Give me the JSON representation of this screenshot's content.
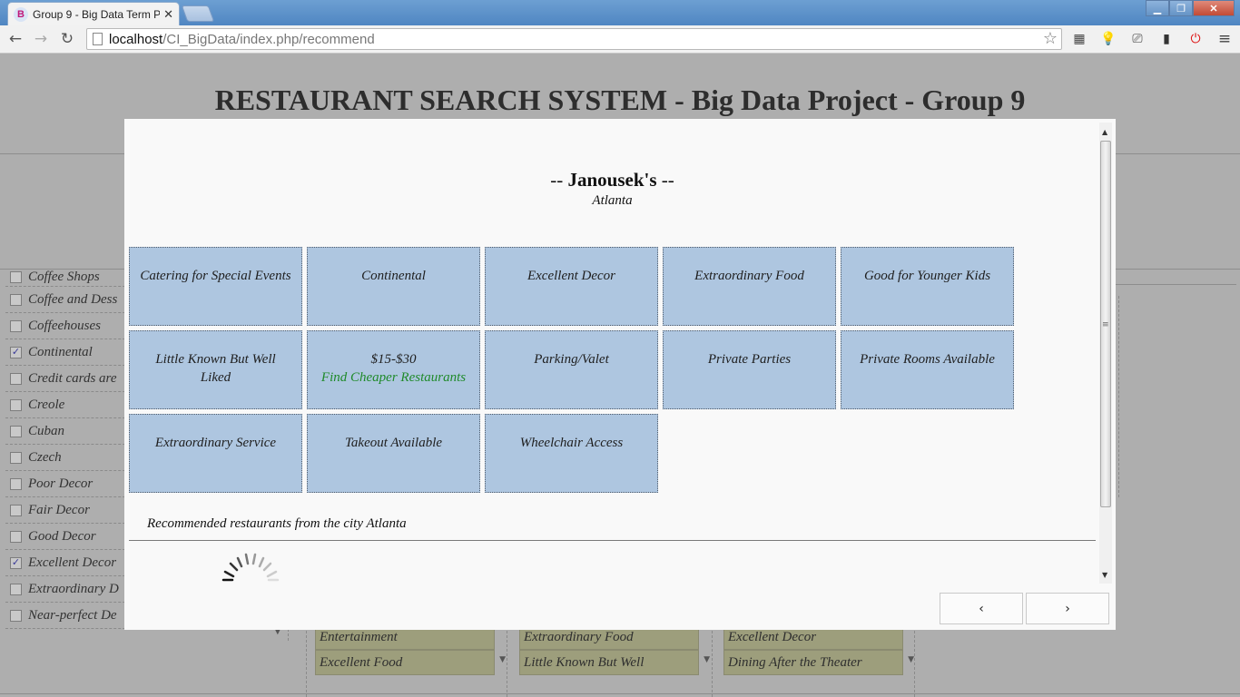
{
  "browser": {
    "tab_title": "Group 9 - Big Data Term P",
    "tab_favicon": "B",
    "url_host": "localhost",
    "url_path": "/CI_BigData/index.php/recommend"
  },
  "page": {
    "title": "RESTAURANT SEARCH SYSTEM - Big Data Project - Group 9",
    "filters": [
      {
        "label": "Coffee Shops",
        "checked": false
      },
      {
        "label": "Coffee and Dess",
        "checked": false
      },
      {
        "label": "Coffeehouses",
        "checked": false
      },
      {
        "label": "Continental",
        "checked": true
      },
      {
        "label": "Credit cards are",
        "checked": false
      },
      {
        "label": "Creole",
        "checked": false
      },
      {
        "label": "Cuban",
        "checked": false
      },
      {
        "label": "Czech",
        "checked": false
      },
      {
        "label": "Poor Decor",
        "checked": false
      },
      {
        "label": "Fair Decor",
        "checked": false
      },
      {
        "label": "Good Decor",
        "checked": false
      },
      {
        "label": "Excellent Decor",
        "checked": true
      },
      {
        "label": "Extraordinary D",
        "checked": false
      },
      {
        "label": "Near-perfect De",
        "checked": false
      }
    ],
    "columns": [
      {
        "items": [
          "Entertainment",
          "Excellent Food"
        ]
      },
      {
        "items": [
          "Extraordinary Food",
          "Little Known But Well"
        ]
      },
      {
        "items": [
          "Excellent Decor",
          "Dining After the Theater"
        ]
      }
    ]
  },
  "modal": {
    "restaurant_name": "Janousek's",
    "name_prefix": "--",
    "name_suffix": "--",
    "city": "Atlanta",
    "features": [
      {
        "label": "Catering for Special Events"
      },
      {
        "label": "Continental"
      },
      {
        "label": "Excellent Decor"
      },
      {
        "label": "Extraordinary Food"
      },
      {
        "label": "Good for Younger Kids"
      },
      {
        "label": "Little Known But Well Liked"
      },
      {
        "label": "$15-$30",
        "link": "Find Cheaper Restaurants"
      },
      {
        "label": "Parking/Valet"
      },
      {
        "label": "Private Parties"
      },
      {
        "label": "Private Rooms Available"
      },
      {
        "label": "Extraordinary Service"
      },
      {
        "label": "Takeout Available"
      },
      {
        "label": "Wheelchair Access"
      }
    ],
    "recommend_label": "Recommended restaurants from the city Atlanta",
    "prev_label": "‹",
    "next_label": "›"
  },
  "colors": {
    "tile_bg": "#aec6e0",
    "link_green": "#1f8a2a",
    "overlay_gray": "#aeaeae",
    "pill_bg": "#9d9e7c"
  }
}
